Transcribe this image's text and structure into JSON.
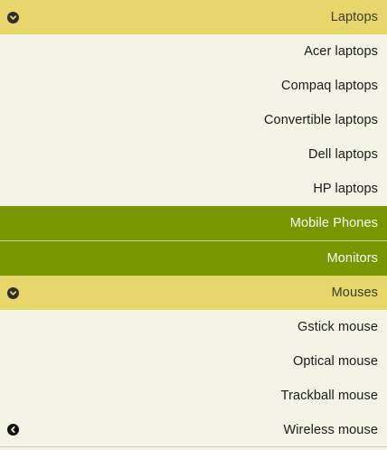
{
  "menu": {
    "laptops": {
      "label": "Laptops",
      "icon": "chevron-down-circle-icon",
      "items": [
        {
          "label": "Acer laptops"
        },
        {
          "label": "Compaq laptops"
        },
        {
          "label": "Convertible laptops"
        },
        {
          "label": "Dell laptops"
        },
        {
          "label": "HP laptops"
        }
      ]
    },
    "mobile_phones": {
      "label": "Mobile Phones"
    },
    "monitors": {
      "label": "Monitors"
    },
    "mouses": {
      "label": "Mouses",
      "icon": "chevron-down-circle-icon",
      "items": [
        {
          "label": "Gstick mouse"
        },
        {
          "label": "Optical mouse"
        },
        {
          "label": "Trackball mouse"
        },
        {
          "label": "Wireless mouse",
          "icon": "chevron-left-circle-icon"
        }
      ]
    }
  },
  "colors": {
    "header_bg": "#e6d66b",
    "sub_bg": "#f3f4e6",
    "active_bg": "#789600"
  }
}
